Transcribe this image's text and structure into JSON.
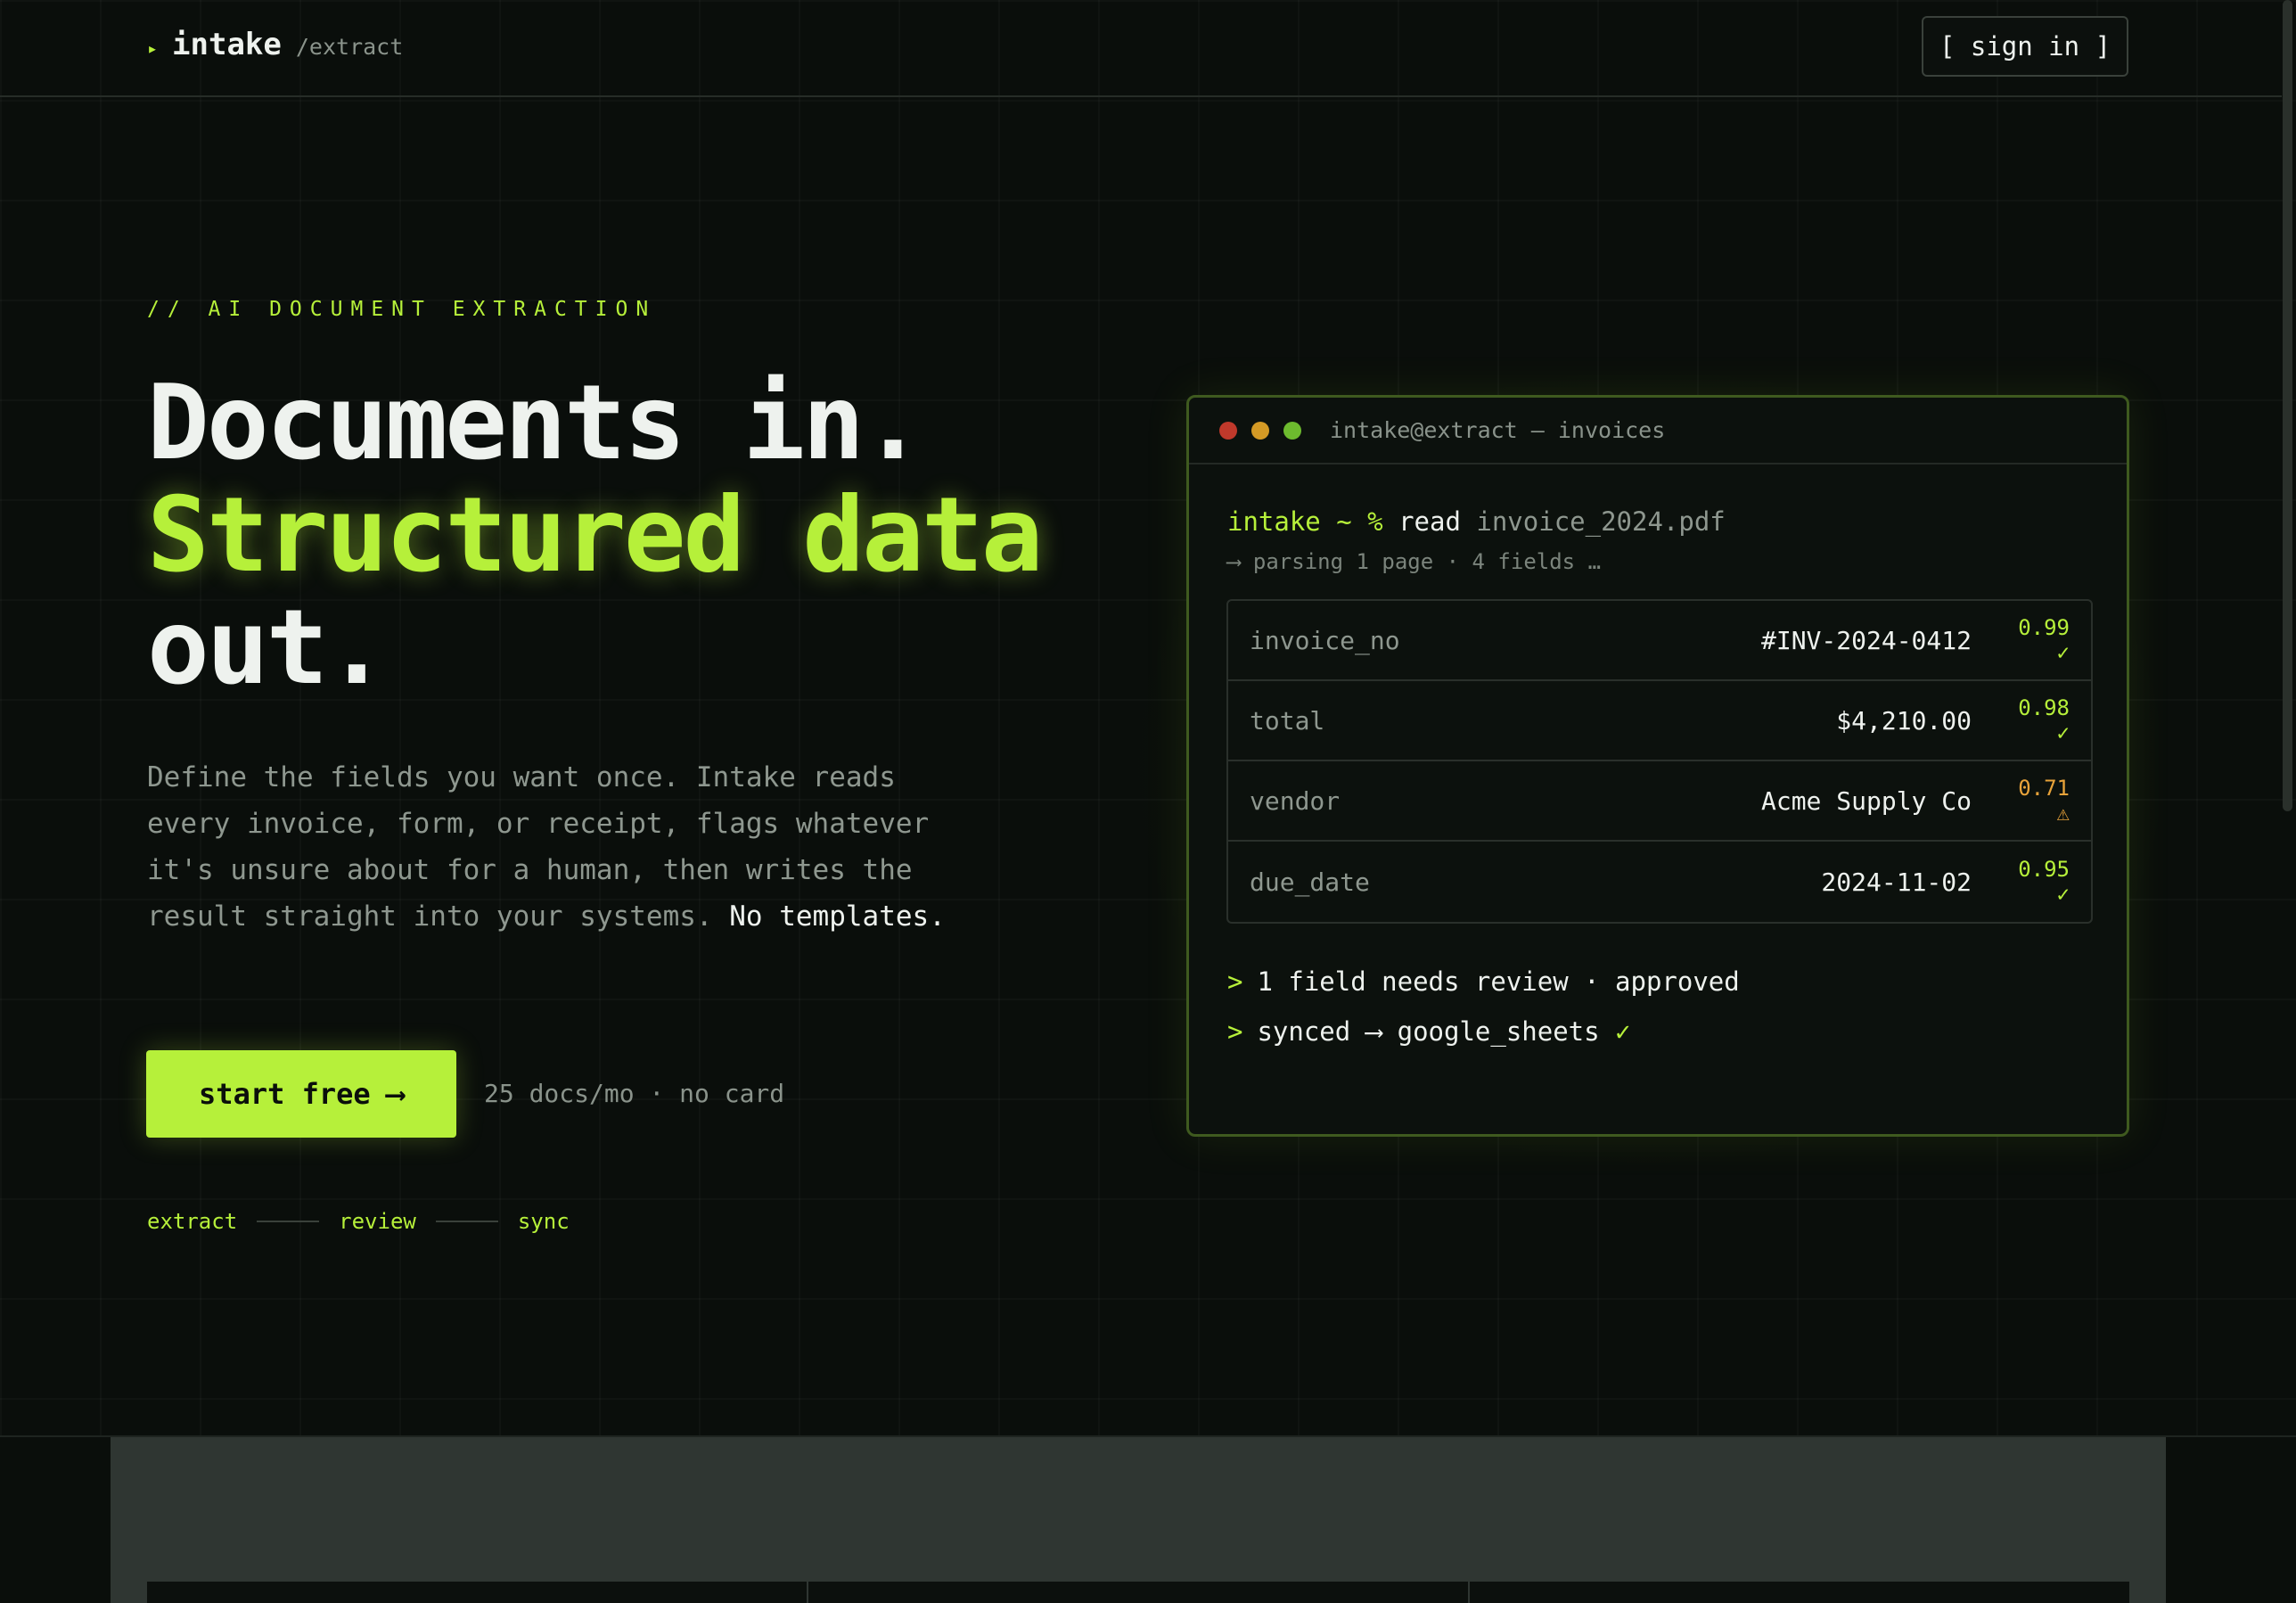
{
  "header": {
    "brand_arrow": "▸",
    "brand_name": "intake",
    "brand_path": "/extract",
    "signin_label": "[ sign in ]"
  },
  "hero": {
    "eyebrow": "// AI DOCUMENT EXTRACTION",
    "title_line1": "Documents in.",
    "title_line2": "Structured data",
    "title_line3": "out.",
    "description": "Define the fields you want once. Intake reads every invoice, form, or receipt, flags whatever it's unsure about for a human, then writes the result straight into your systems.",
    "description_strong": "No templates.",
    "cta_label": "start free",
    "cta_arrow": "⟶",
    "cta_note": "25 docs/mo · no card",
    "steps": [
      "extract",
      "review",
      "sync"
    ]
  },
  "terminal": {
    "title": "intake@extract — invoices",
    "prompt": "intake ~ %",
    "command": "read",
    "argument": "invoice_2024.pdf",
    "parsing": "⟶ parsing 1 page · 4 fields …",
    "fields": [
      {
        "key": "invoice_no",
        "value": "#INV-2024-0412",
        "confidence": "0.99 ✓",
        "status": "ok"
      },
      {
        "key": "total",
        "value": "$4,210.00",
        "confidence": "0.98 ✓",
        "status": "ok"
      },
      {
        "key": "vendor",
        "value": "Acme Supply Co",
        "confidence": "0.71 ⚠",
        "status": "warn"
      },
      {
        "key": "due_date",
        "value": "2024-11-02",
        "confidence": "0.95 ✓",
        "status": "ok"
      }
    ],
    "log_prefix": ">",
    "log1": "1 field needs review · approved",
    "log2_text": "synced ⟶ google_sheets",
    "log2_check": "✓"
  },
  "colors": {
    "accent": "#b6f03a",
    "warning": "#e8a33a",
    "background": "#0a0e0b"
  }
}
